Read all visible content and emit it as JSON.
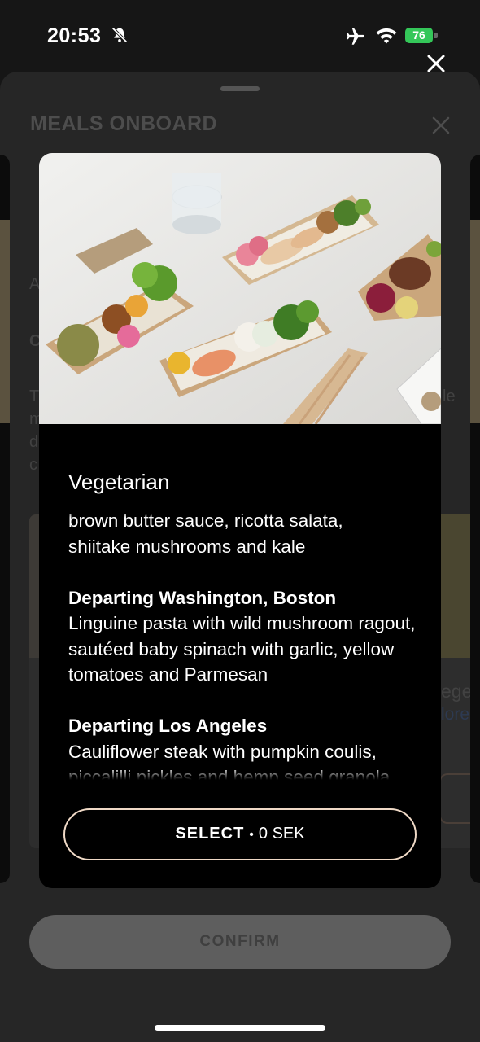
{
  "status_bar": {
    "time": "20:53",
    "battery": "76"
  },
  "sheet": {
    "title": "MEALS ONBOARD",
    "bg_frag_a": "A",
    "bg_frag_c": "C",
    "bg_frag_t": "T",
    "bg_frag_m": "m",
    "bg_frag_d": "d",
    "bg_frag_c2": "c",
    "bg_frag_le": "le",
    "bg_frag_ege": "ege",
    "bg_frag_lore": "lore",
    "confirm_label": "CONFIRM"
  },
  "meal": {
    "title": "Vegetarian",
    "cut_line": "brown butter sauce, ricotta salata,",
    "cut_line2": "shiitake mushrooms and kale",
    "sections": [
      {
        "heading": "Departing Washington, Boston",
        "text": "Linguine pasta with wild mushroom ragout, sautéed baby spinach with garlic, yellow tomatoes and Parmesan"
      },
      {
        "heading": "Departing Los Angeles",
        "text": "Cauliflower steak with pumpkin coulis, piccalilli pickles and hemp seed granola"
      }
    ],
    "select_label": "SELECT",
    "select_separator": "•",
    "price": "0 SEK"
  },
  "icons": {
    "bell": "bell-slash-icon",
    "plane": "airplane-icon",
    "wifi": "wifi-icon",
    "close": "close-icon"
  }
}
